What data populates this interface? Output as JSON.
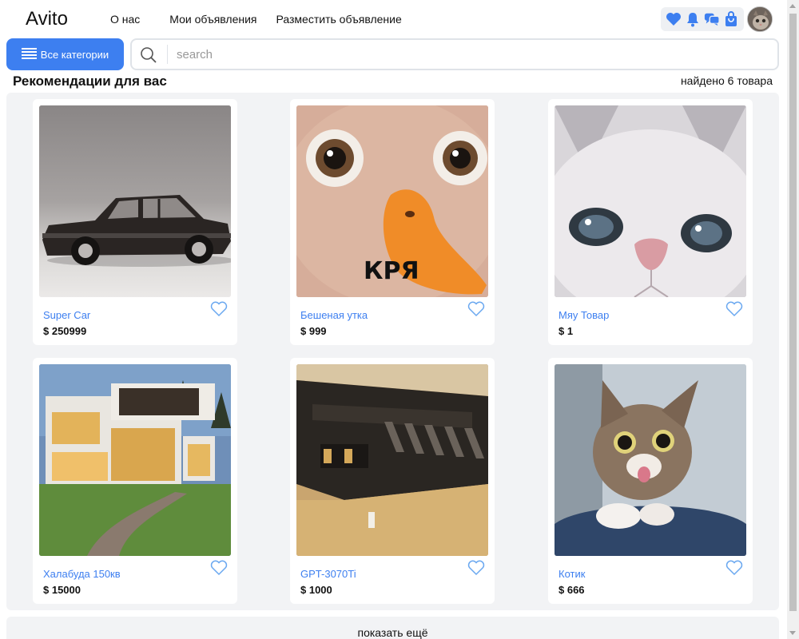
{
  "header": {
    "logo": "Avito",
    "nav": [
      "О нас",
      "Мои объявления",
      "Разместить объявление"
    ]
  },
  "toolbar": {
    "categories_label": "Все категории",
    "search_placeholder": "search"
  },
  "section": {
    "title": "Рекомендации для вас",
    "found": "найдено 6 товара"
  },
  "products": [
    {
      "title": "Super Car",
      "price": "$ 250999"
    },
    {
      "title": "Бешеная утка",
      "price": "$ 999"
    },
    {
      "title": "Мяу Товар",
      "price": "$ 1"
    },
    {
      "title": "Халабуда 150кв",
      "price": "$ 15000"
    },
    {
      "title": "GPT-3070Ti",
      "price": "$ 1000"
    },
    {
      "title": "Котик",
      "price": "$ 666"
    }
  ],
  "duck_caption": "КРЯ",
  "more_label": "показать ещё",
  "icons": {
    "favorites": "heart-icon",
    "notifications": "bell-icon",
    "messages": "chat-icon",
    "cart": "shopping-bag-icon",
    "menu": "hamburger-icon",
    "search": "search-icon",
    "like": "heart-outline-icon"
  },
  "colors": {
    "accent": "#3d7ff0",
    "panel": "#f2f3f5"
  }
}
